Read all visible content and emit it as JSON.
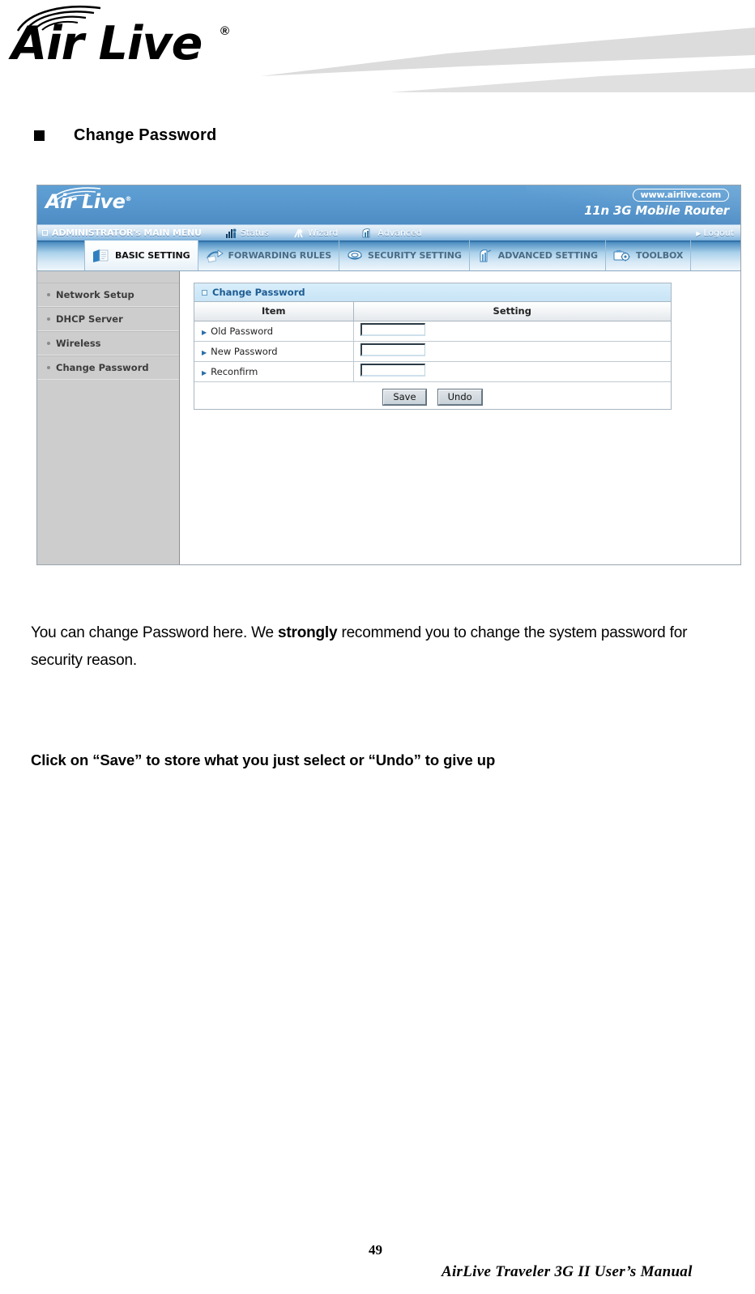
{
  "document": {
    "brand": {
      "wordmark": "Air Live",
      "registered_mark": "®"
    },
    "section": {
      "heading": "Change Password"
    },
    "body_paragraph": {
      "part1": "You can change Password here. We ",
      "emphasis": "strongly",
      "part2": " recommend you to change the system password for security reason."
    },
    "instruction": "Click on “Save” to store what you just select or “Undo” to give up",
    "footer": {
      "page_number": "49",
      "manual_title": "AirLive  Traveler  3G  II  User’s  Manual"
    }
  },
  "router_ui": {
    "header": {
      "logo_text": "Air Live",
      "logo_reg": "®",
      "url_badge": "www.airlive.com",
      "model_name": "11n 3G Mobile Router"
    },
    "menubar": {
      "main_menu_label": "ADMINISTRATOR's MAIN MENU",
      "items": [
        {
          "label": "Status",
          "icon": "status-bars-icon"
        },
        {
          "label": "Wizard",
          "icon": "wizard-wand-icon"
        },
        {
          "label": "Advanced",
          "icon": "advanced-chart-icon"
        }
      ],
      "logout_label": "Logout",
      "logout_arrow": "▶"
    },
    "tabs": [
      {
        "label": "BASIC SETTING",
        "icon": "folder-document-icon",
        "active": true
      },
      {
        "label": "FORWARDING RULES",
        "icon": "forward-arrow-icon",
        "active": false
      },
      {
        "label": "SECURITY SETTING",
        "icon": "shield-disc-icon",
        "active": false
      },
      {
        "label": "ADVANCED SETTING",
        "icon": "tower-building-icon",
        "active": false
      },
      {
        "label": "TOOLBOX",
        "icon": "toolbox-gear-icon",
        "active": false
      }
    ],
    "sidebar": {
      "items": [
        {
          "label": "Network Setup"
        },
        {
          "label": "DHCP Server"
        },
        {
          "label": "Wireless"
        },
        {
          "label": "Change Password"
        }
      ]
    },
    "panel": {
      "title": "Change Password",
      "columns": {
        "item": "Item",
        "setting": "Setting"
      },
      "rows": [
        {
          "label": "Old Password",
          "value": "",
          "type": "password"
        },
        {
          "label": "New Password",
          "value": "",
          "type": "password"
        },
        {
          "label": "Reconfirm",
          "value": "",
          "type": "password"
        }
      ],
      "buttons": {
        "save": "Save",
        "undo": "Undo"
      }
    },
    "colors": {
      "header_blue": "#5696cd",
      "tab_bar_blue": "#a9d0ea",
      "panel_title_blue": "#c7e4f6",
      "panel_title_text": "#1d5c93",
      "sidebar_grey": "#cdcdcd"
    }
  }
}
